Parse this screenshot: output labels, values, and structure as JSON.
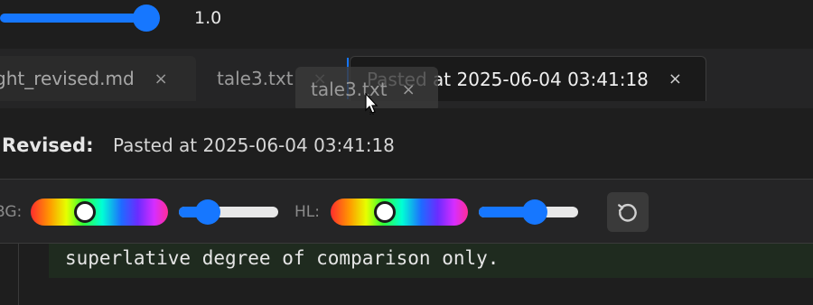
{
  "zoom": {
    "value_label": "1.0",
    "level": 1.0
  },
  "tabs": [
    {
      "label": "ght_revised.md",
      "close": "×",
      "active": false
    },
    {
      "label": "tale3.txt",
      "close": "×",
      "active": false
    },
    {
      "label": "Pasted at 2025-06-04 03:41:18",
      "close": "×",
      "active": true
    }
  ],
  "drag_ghost": {
    "label": "tale3.txt",
    "close": "×"
  },
  "revised": {
    "label": "Revised:",
    "value": "Pasted at 2025-06-04 03:41:18"
  },
  "controls": {
    "bg_label": "BG:",
    "hl_label": "HL:",
    "bg_hue_position": 0.37,
    "bg_opacity": 0.22,
    "hl_hue_position": 0.37,
    "hl_opacity": 0.58,
    "accent_color": "#1677ff"
  },
  "editor": {
    "line": "superlative degree of comparison only."
  }
}
